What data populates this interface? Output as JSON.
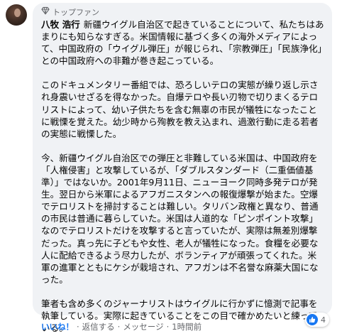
{
  "comment": {
    "badge_label": "トップファン",
    "badge_icon": "diamond-icon",
    "author": "八牧 浩行",
    "paragraphs": [
      "新疆ウイグル自治区で起きていることについて、私たちはあまりにも知らなすぎる。米国情報に基づく多くの海外メディアによって、中国政府の「ウイグル弾圧」が報じられ、「宗教弾圧」「民族浄化」との中国政府への非難が巻き起こっている。",
      "このドキュメンタリー番組では、恐ろしいテロの実態が繰り返し示され身震いせざるを得なかった。自爆テロや長い刃物で切りまくるテロリストによって、幼い子供たちを含む無辜の市民が犠牲になったことに戦慄を覚えた。幼少時から殉教を教え込まれ、過激行動に走る若者の実態に戦慄した。",
      "今、新疆ウイグル自治区での弾圧と非難している米国は、中国政府を「人権侵害」と攻撃しているが、「ダブルスタンダード（二重価値基準）」ではないか。2001年9月11日、ニューヨーク同時多発テロが発生。翌日から米軍によるアフガニスタンへの報復爆撃が始また。空爆でテロリストを掃討することは難しい。タリバン政権と異なり、普通の市民は普通に暮らしていた。米国は人道的な「ピンポイント攻撃」なのでテロリストだけを攻撃すると言っていたが、実際は無差別爆撃だった。真っ先に子どもや女性、老人が犠牲になった。食糧を必要な人に配給できるよう尽力したが、ボランティアが頑張ってくれた。米軍の進軍とともにケシが栽培され、アフガンは不名誉な麻薬大国になった。",
      "筆者も含め多くのジャーナリストはウイグルに行かずに憶測で記事を執筆している。実際に起きていることをこの目で確かめたいと練っている。"
    ]
  },
  "actions": {
    "like": "いいね！",
    "separator": "·",
    "reply": "返信する",
    "message": "メッセージ",
    "time": "1時間前"
  },
  "reactions": {
    "icon": "thumbs-up-icon",
    "count": "4"
  },
  "colors": {
    "bubble": "#f0f2f5",
    "like_blue": "#1877f2",
    "meta_gray": "#65676b"
  }
}
